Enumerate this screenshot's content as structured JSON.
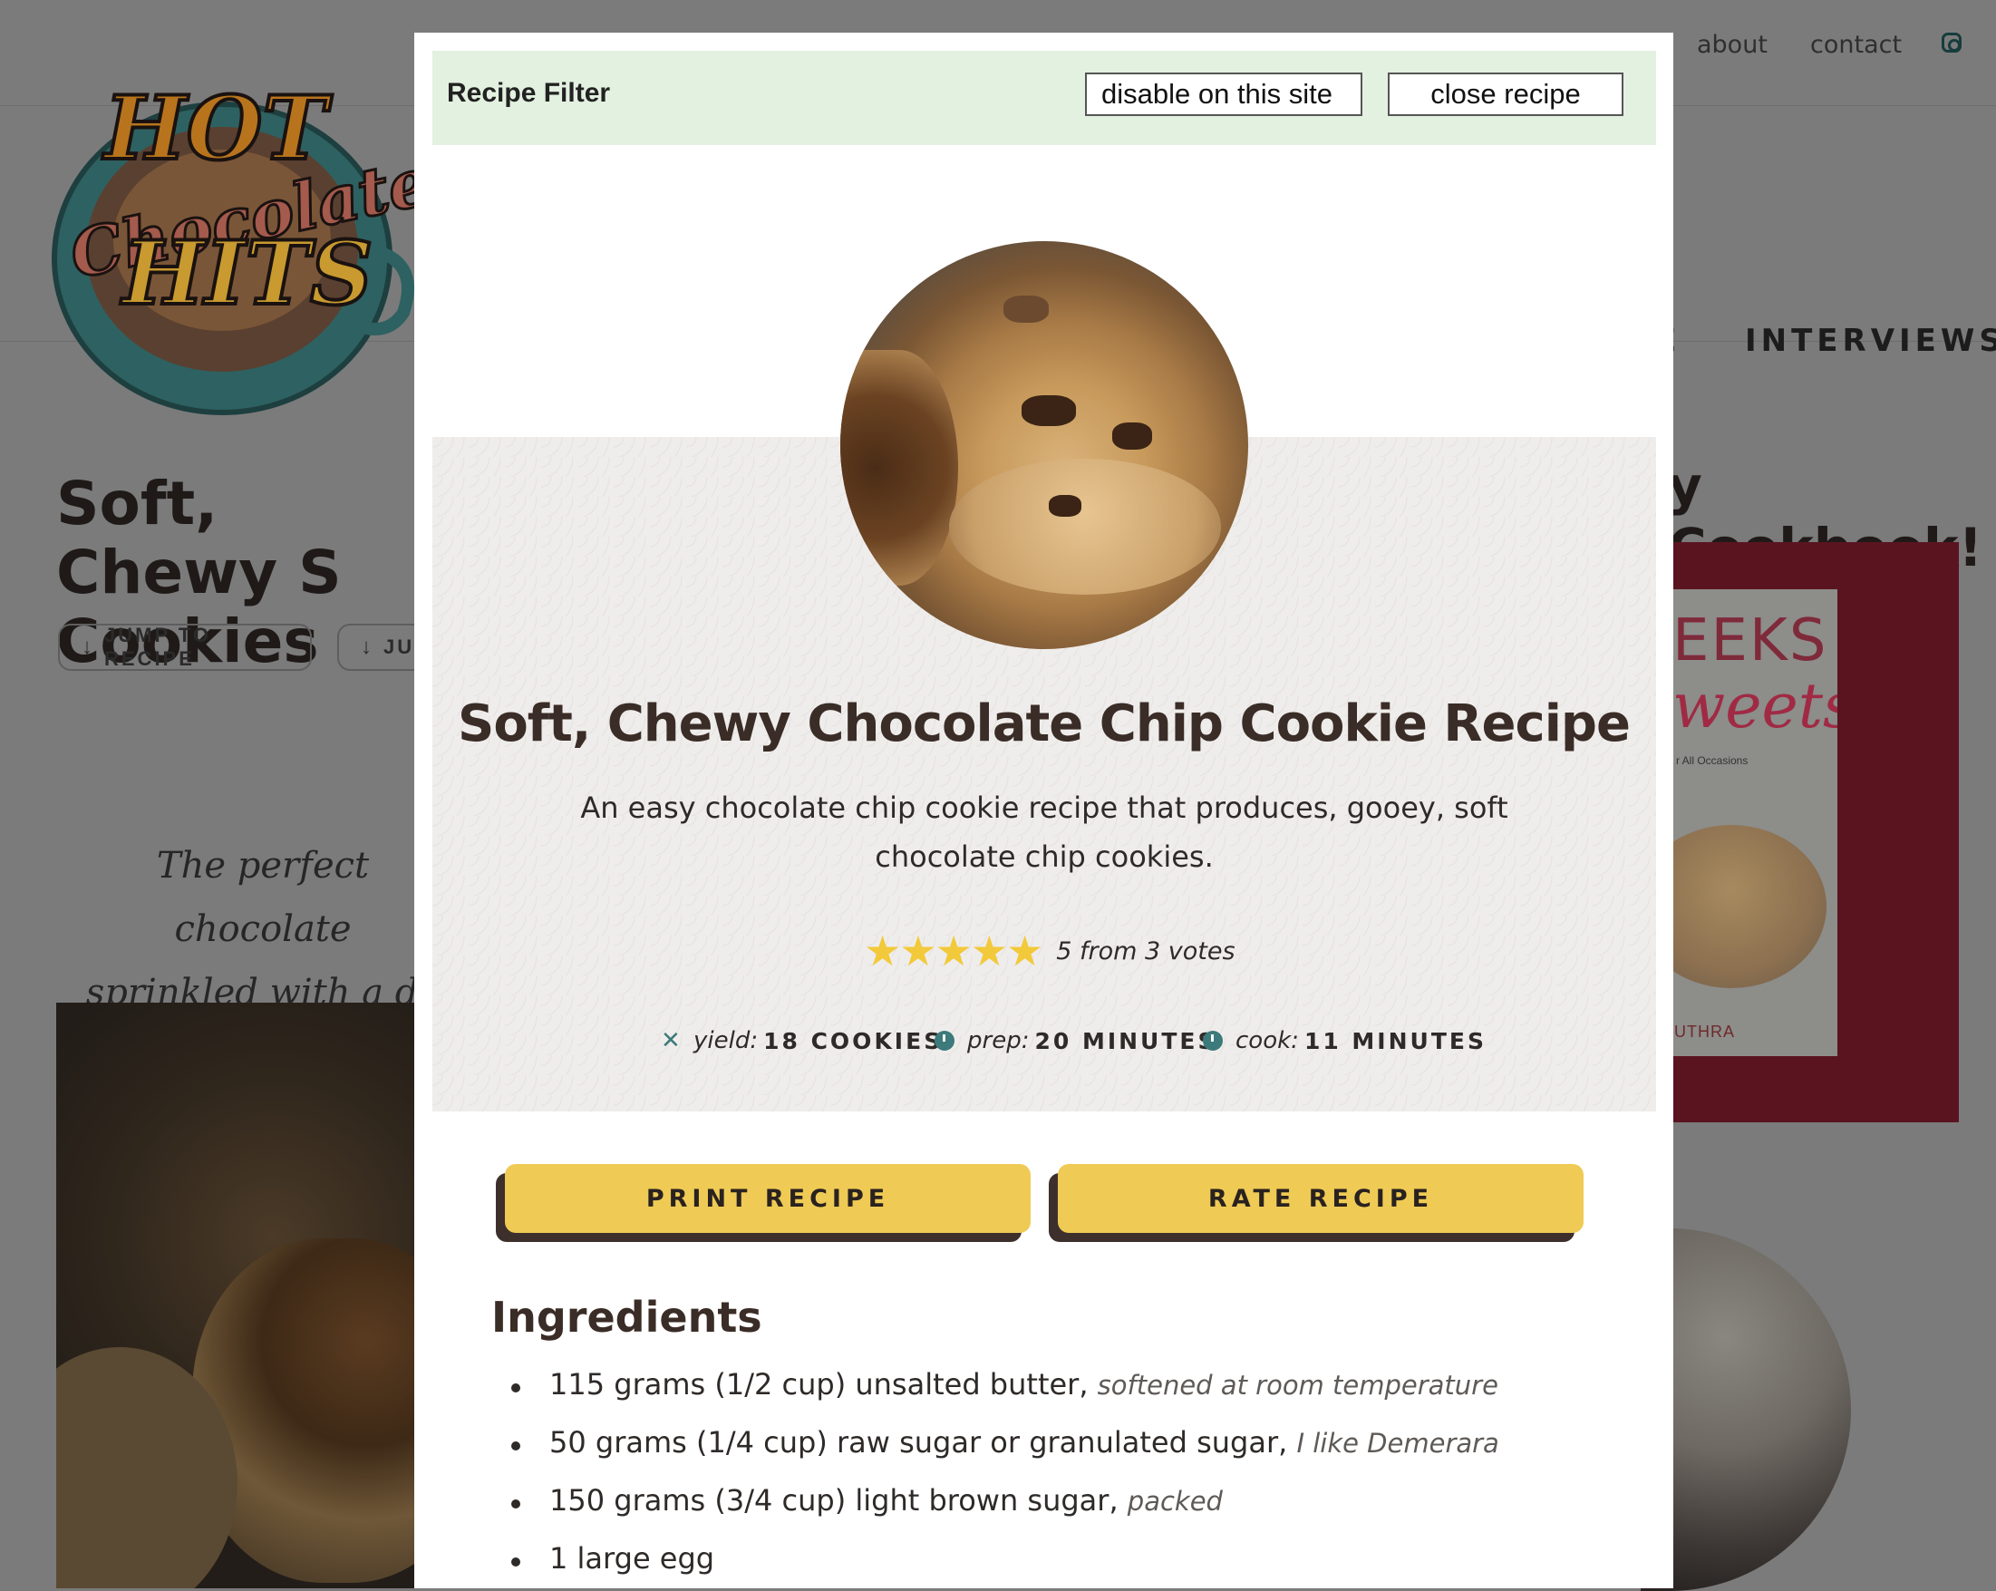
{
  "background_page": {
    "top_links": [
      "about",
      "contact"
    ],
    "nav_items": [
      "E",
      "INTERVIEWS"
    ],
    "logo_text": [
      "HOT",
      "Chocolate",
      "HITS"
    ],
    "post_title": "Soft, Chewy S\nCookies",
    "jump_buttons": [
      "JUMP TO RECIPE",
      "JU"
    ],
    "intro_text": "The perfect chocolate\nsprinkled with a da",
    "sidebar_heading": "y Cookbook!",
    "book": {
      "line1": "EEKS",
      "line2": "weets",
      "line3": "r All Occasions",
      "author": "UTHRA"
    }
  },
  "filter_bar": {
    "title": "Recipe Filter",
    "disable_label": "disable on this site",
    "close_label": "close recipe"
  },
  "recipe": {
    "title": "Soft, Chewy Chocolate Chip Cookie Recipe",
    "summary": "An easy chocolate chip cookie recipe that produces, gooey, soft chocolate chip cookies.",
    "rating": {
      "stars": 5,
      "max_stars": 5,
      "text": "5 from 3 votes"
    },
    "meta": [
      {
        "icon": "utensils-icon",
        "label": "yield:",
        "value": "18 COOKIES"
      },
      {
        "icon": "clock-icon",
        "label": "prep:",
        "value": "20 MINUTES"
      },
      {
        "icon": "clock-icon",
        "label": "cook:",
        "value": "11 MINUTES"
      }
    ],
    "print_label": "PRINT RECIPE",
    "rate_label": "RATE RECIPE",
    "ingredients_heading": "Ingredients",
    "ingredients": [
      {
        "text": "115 grams (1/2 cup) unsalted butter,",
        "note": "softened at room temperature"
      },
      {
        "text": "50 grams (1/4 cup) raw sugar or granulated sugar,",
        "note": "I like Demerara"
      },
      {
        "text": "150 grams (3/4 cup) light brown sugar,",
        "note": "packed"
      },
      {
        "text": "1 large egg",
        "note": ""
      }
    ]
  },
  "colors": {
    "accent_button": "#efcb55",
    "icon_teal": "#3c7a7b",
    "star": "#f2c93a",
    "filter_bar_bg": "#e3f1e0"
  }
}
